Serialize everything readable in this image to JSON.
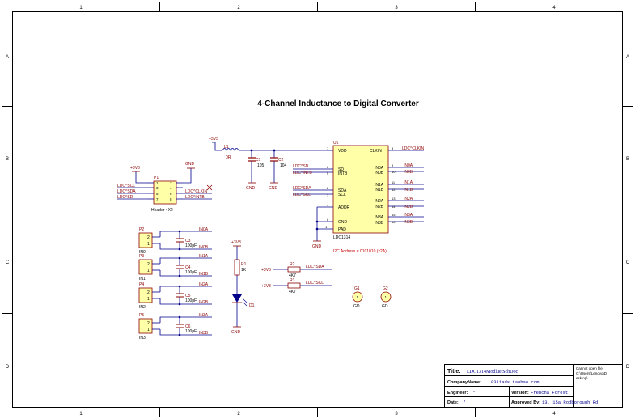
{
  "colors": {
    "wire": "#00008b",
    "net": "#8b0000",
    "part": "#8b0000",
    "body_fill": "#ffffa8",
    "frame": "#000000",
    "note": "#cc0000"
  },
  "frame": {
    "columns": [
      "1",
      "2",
      "3",
      "4"
    ],
    "rows": [
      "A",
      "B",
      "C",
      "D"
    ]
  },
  "title": "4-Channel Inductance to Digital Converter",
  "power": {
    "v33": "+3V3",
    "gnd": "GND"
  },
  "inductor": {
    "ref": "L1",
    "value": "0R"
  },
  "caps_top": [
    {
      "ref": "C1",
      "value": "105"
    },
    {
      "ref": "C2",
      "value": "104"
    }
  ],
  "header": {
    "ref": "P1",
    "name": "Header 4X2",
    "pins": [
      "1",
      "2",
      "3",
      "4",
      "5",
      "6",
      "7",
      "8"
    ],
    "left_nets": [
      "LDC^SCL",
      "LDC^SDA",
      "LDC^SD"
    ],
    "right_nets": [
      "LDC^CLKIN",
      "LDC^INTB"
    ]
  },
  "ldc": {
    "ref": "U1",
    "name": "LDC1314",
    "left_pins": [
      {
        "num": "7",
        "name": "VDD"
      },
      {
        "num": "6",
        "name": "SD"
      },
      {
        "num": "5",
        "name": "INTB"
      },
      {
        "num": "2",
        "name": "SDA"
      },
      {
        "num": "1",
        "name": "SCL"
      },
      {
        "num": "4",
        "name": "ADDR"
      },
      {
        "num": "8",
        "name": "GND"
      },
      {
        "num": "17",
        "name": "PAD"
      }
    ],
    "right_pins": [
      {
        "num": "3",
        "name": "CLKIN"
      },
      {
        "num": "9",
        "name": "IN0A"
      },
      {
        "num": "10",
        "name": "IN0B"
      },
      {
        "num": "11",
        "name": "IN1A"
      },
      {
        "num": "12",
        "name": "IN1B"
      },
      {
        "num": "13",
        "name": "IN2A"
      },
      {
        "num": "14",
        "name": "IN2B"
      },
      {
        "num": "15",
        "name": "IN3A"
      },
      {
        "num": "16",
        "name": "IN3B"
      }
    ],
    "left_nets": [
      "LDC^SD",
      "LDC^INTB",
      "LDC^SDA",
      "LDC^SCL"
    ],
    "right_nets": [
      "LDC^CLKIN",
      "IN0A",
      "IN0B",
      "IN1A",
      "IN1B",
      "IN2A",
      "IN2B",
      "IN3A",
      "IN3B"
    ],
    "address_note": "I2C Address = 0101010 (x2A)"
  },
  "coils": [
    {
      "ref": "P2",
      "name": "IN0",
      "cap": "C3",
      "cap_value": "100pF",
      "net_a": "IN0A",
      "net_b": "IN0B"
    },
    {
      "ref": "P3",
      "name": "IN1",
      "cap": "C4",
      "cap_value": "100pF",
      "net_a": "IN1A",
      "net_b": "IN1B"
    },
    {
      "ref": "P4",
      "name": "IN2",
      "cap": "C5",
      "cap_value": "100pF",
      "net_a": "IN2A",
      "net_b": "IN2B"
    },
    {
      "ref": "P5",
      "name": "IN3",
      "cap": "C6",
      "cap_value": "100pF",
      "net_a": "IN3A",
      "net_b": "IN3B"
    }
  ],
  "coil_pins": [
    "2",
    "1"
  ],
  "led": {
    "res_ref": "R1",
    "res_value": "1K",
    "led_ref": "D1"
  },
  "pullups": [
    {
      "ref": "R2",
      "value": "4K7",
      "net": "LDC^SDA"
    },
    {
      "ref": "R3",
      "value": "4K7",
      "net": "LDC^SCL"
    }
  ],
  "mounts": [
    {
      "ref": "G1",
      "inner": "1",
      "label": "GD"
    },
    {
      "ref": "G2",
      "inner": "1",
      "label": "GD"
    }
  ],
  "title_block": {
    "title_label": "Title:",
    "title_value": "LDC1314Modlue.SchDoc",
    "company_label": "CompanyName:",
    "company_value": "0311ads.taobao.com",
    "engineer_label": "Engineer:",
    "engineer_value": "*",
    "version_label": "Version:",
    "version_value": "Frencha Forest",
    "date_label": "Date:",
    "date_value": "*",
    "approved_label": "Approved By:",
    "approved_value": "13, 15a Rodborough Rd",
    "file_note": [
      "Cannot open file",
      "C:\\Users\\Lenovo\\D",
      "esktop\\"
    ]
  }
}
